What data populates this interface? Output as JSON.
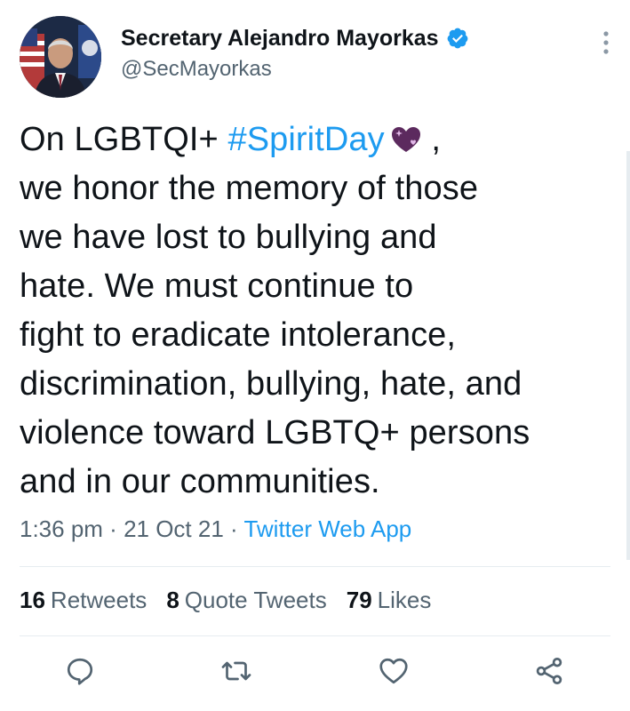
{
  "author": {
    "display_name": "Secretary Alejandro Mayorkas",
    "handle": "@SecMayorkas",
    "verified": true,
    "avatar_icon": "profile-photo"
  },
  "tweet": {
    "lines": [
      {
        "prefix": "On LGBTQI+ ",
        "hashtag": "#SpiritDay",
        "suffix": " ,",
        "emoji": "purple-heart-sparkle"
      },
      {
        "text": "we honor the memory of those"
      },
      {
        "text": "we have lost to bullying and"
      },
      {
        "text": "hate. We must continue to"
      },
      {
        "text": "fight to eradicate intolerance,"
      },
      {
        "text": "discrimination, bullying, hate, and"
      },
      {
        "text": "violence toward LGBTQ+ persons"
      },
      {
        "text": "and in our communities."
      }
    ]
  },
  "meta": {
    "time": "1:36 pm",
    "sep1": " · ",
    "date": "21 Oct 21",
    "sep2": " · ",
    "source": "Twitter Web App"
  },
  "stats": [
    {
      "count": "16",
      "label": "Retweets"
    },
    {
      "count": "8",
      "label": "Quote Tweets"
    },
    {
      "count": "79",
      "label": "Likes"
    }
  ],
  "actions": {
    "reply_icon": "reply-icon",
    "retweet_icon": "retweet-icon",
    "like_icon": "heart-icon",
    "share_icon": "share-icon"
  },
  "colors": {
    "link": "#1d9bf0",
    "text": "#0f1419",
    "secondary": "#536471",
    "divider": "#e6ecf0",
    "verified": "#1d9bf0"
  }
}
